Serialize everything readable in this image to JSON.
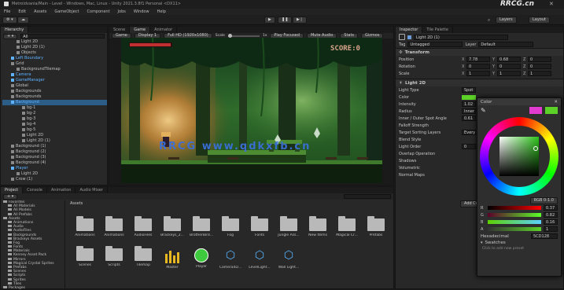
{
  "title_bar": {
    "title": "Metroidvania/Main - Level - Windows, Mac, Linux - Unity 2021.3.8f1 Personal <DX11>",
    "watermark_tr": "RRCG.cn"
  },
  "menu": [
    "File",
    "Edit",
    "Assets",
    "GameObject",
    "Component",
    "Jobs",
    "Window",
    "Help"
  ],
  "toolbar": {
    "account": "Account",
    "layers": "Layers",
    "layout": "Layout",
    "play": "▶",
    "pause": "❚❚",
    "step": "▶❘"
  },
  "hierarchy": {
    "tab": "Hierarchy",
    "search_placeholder": "All",
    "items": [
      {
        "label": "Light 2D",
        "indent": 2,
        "blue": false
      },
      {
        "label": "Light 2D (1)",
        "indent": 2,
        "blue": false
      },
      {
        "label": "Objects",
        "indent": 2,
        "blue": false
      },
      {
        "label": "Left Boundary",
        "indent": 1,
        "blue": true
      },
      {
        "label": "Grid",
        "indent": 1,
        "blue": false
      },
      {
        "label": "BackgroundTilemap",
        "indent": 2,
        "blue": false
      },
      {
        "label": "Camera",
        "indent": 1,
        "blue": true
      },
      {
        "label": "GameManager",
        "indent": 1,
        "blue": true
      },
      {
        "label": "Global",
        "indent": 1,
        "blue": false
      },
      {
        "label": "Backgrounds",
        "indent": 1,
        "blue": false
      },
      {
        "label": "Backgrounds",
        "indent": 1,
        "blue": false
      },
      {
        "label": "Background",
        "indent": 1,
        "blue": true,
        "selected": true
      },
      {
        "label": "bg-1",
        "indent": 3,
        "blue": false
      },
      {
        "label": "bg-2",
        "indent": 3,
        "blue": false
      },
      {
        "label": "bg-3",
        "indent": 3,
        "blue": false
      },
      {
        "label": "bg-4",
        "indent": 3,
        "blue": false
      },
      {
        "label": "bg-5",
        "indent": 3,
        "blue": false
      },
      {
        "label": "Light 2D",
        "indent": 3,
        "blue": false
      },
      {
        "label": "Light 2D (1)",
        "indent": 3,
        "blue": false
      },
      {
        "label": "Background (1)",
        "indent": 1,
        "blue": false
      },
      {
        "label": "Background (2)",
        "indent": 1,
        "blue": false
      },
      {
        "label": "Background (3)",
        "indent": 1,
        "blue": false
      },
      {
        "label": "Background (4)",
        "indent": 1,
        "blue": false
      },
      {
        "label": "Player",
        "indent": 1,
        "blue": true
      },
      {
        "label": "Light 2D",
        "indent": 2,
        "blue": false
      },
      {
        "label": "Crow (1)",
        "indent": 1,
        "blue": false
      }
    ]
  },
  "scene_tabs": [
    "Scene",
    "Game",
    "Animator"
  ],
  "game_bar": {
    "display": "Game",
    "display_num": "Display 1",
    "aspect": "Full HD (1920x1080)",
    "scale_label": "Scale",
    "scale_value": "1x",
    "play_mode": "Play Focused",
    "mute": "Mute Audio",
    "stats": "Stats",
    "gizmos": "Gizmos"
  },
  "game": {
    "score": "SCORE:0",
    "watermark": "RRCG www.qdkxfb.cn"
  },
  "project": {
    "tabs": [
      "Project",
      "Console",
      "Animation",
      "Audio Mixer"
    ],
    "breadcrumb": "Assets",
    "tree": [
      "Favorites",
      "All Materials",
      "All Models",
      "All Prefabs",
      "Assets",
      "Animations",
      "Audio",
      "AudioFiles",
      "Backgrounds",
      "Brackeys Assets",
      "Fog",
      "Fonts",
      "Materials",
      "Kenney Asset Pack",
      "Mirrors",
      "Magical Crystal Sprites",
      "Prefabs",
      "Scenes",
      "Scripts",
      "Sprites",
      "Tiles",
      "Packages"
    ],
    "assets_row1": [
      "Animations",
      "Animations",
      "AudioFiles",
      "Brackeys_2...",
      "BrotherBird...",
      "Fog",
      "Fonts",
      "Jungle Ass...",
      "New Items",
      "Magical Cr...",
      "Prefabs"
    ],
    "assets_row2": [
      {
        "label": "Scenes",
        "kind": "folder"
      },
      {
        "label": "Scripts",
        "kind": "folder"
      },
      {
        "label": "Tilemap",
        "kind": "folder"
      },
      {
        "label": "Master",
        "kind": "mixer"
      },
      {
        "label": "Player",
        "kind": "ball"
      },
      {
        "label": "Camera4D...",
        "kind": "script"
      },
      {
        "label": "LevelLight...",
        "kind": "script"
      },
      {
        "label": "Wall Light...",
        "kind": "script"
      }
    ]
  },
  "inspector": {
    "tabs": [
      "Inspector",
      "Tile Palette"
    ],
    "object_name": "Light 2D (1)",
    "tag_label": "Tag",
    "tag_value": "Untagged",
    "layer_label": "Layer",
    "layer_value": "Default",
    "transform": {
      "header": "Transform",
      "rows": [
        {
          "label": "Position",
          "x": "7.78",
          "y": "0.68",
          "z": "0"
        },
        {
          "label": "Rotation",
          "x": "0",
          "y": "0",
          "z": "0"
        },
        {
          "label": "Scale",
          "x": "1",
          "y": "1",
          "z": "1"
        }
      ]
    },
    "light2d": {
      "header": "Light 2D",
      "rows": [
        {
          "label": "Light Type",
          "value": "Spot"
        },
        {
          "label": "Color",
          "value": ""
        },
        {
          "label": "Intensity",
          "value": "1.02"
        },
        {
          "label": "Radius",
          "value": "Inner 0"
        },
        {
          "label": "Inner / Outer Spot Angle",
          "value": "0.61"
        },
        {
          "label": "Falloff Strength",
          "value": ""
        },
        {
          "label": "Target Sorting Layers",
          "value": "Everything"
        },
        {
          "label": "Blend Style",
          "value": ""
        },
        {
          "label": "Light Order",
          "value": "0"
        },
        {
          "label": "Overlap Operation",
          "value": ""
        },
        {
          "label": "Shadows",
          "value": ""
        },
        {
          "label": "Volumetric",
          "value": ""
        },
        {
          "label": "Normal Maps",
          "value": ""
        }
      ],
      "add_component": "Add Component"
    }
  },
  "color_picker": {
    "title": "Color",
    "mode": "RGB 0-1.0",
    "channels": [
      {
        "label": "R",
        "value": "0.37"
      },
      {
        "label": "G",
        "value": "0.82"
      },
      {
        "label": "B",
        "value": "0.16"
      },
      {
        "label": "A",
        "value": "1"
      }
    ],
    "hex_label": "Hexadecimal",
    "hex_value": "5CD128",
    "swatches_label": "Swatches",
    "swatch_hint": "Click to add new preset"
  },
  "colors": {
    "accent_blue": "#5eb2ff",
    "selection": "#2c5d87",
    "current_color": "#5cd128",
    "prev_color": "#e23bd0"
  }
}
